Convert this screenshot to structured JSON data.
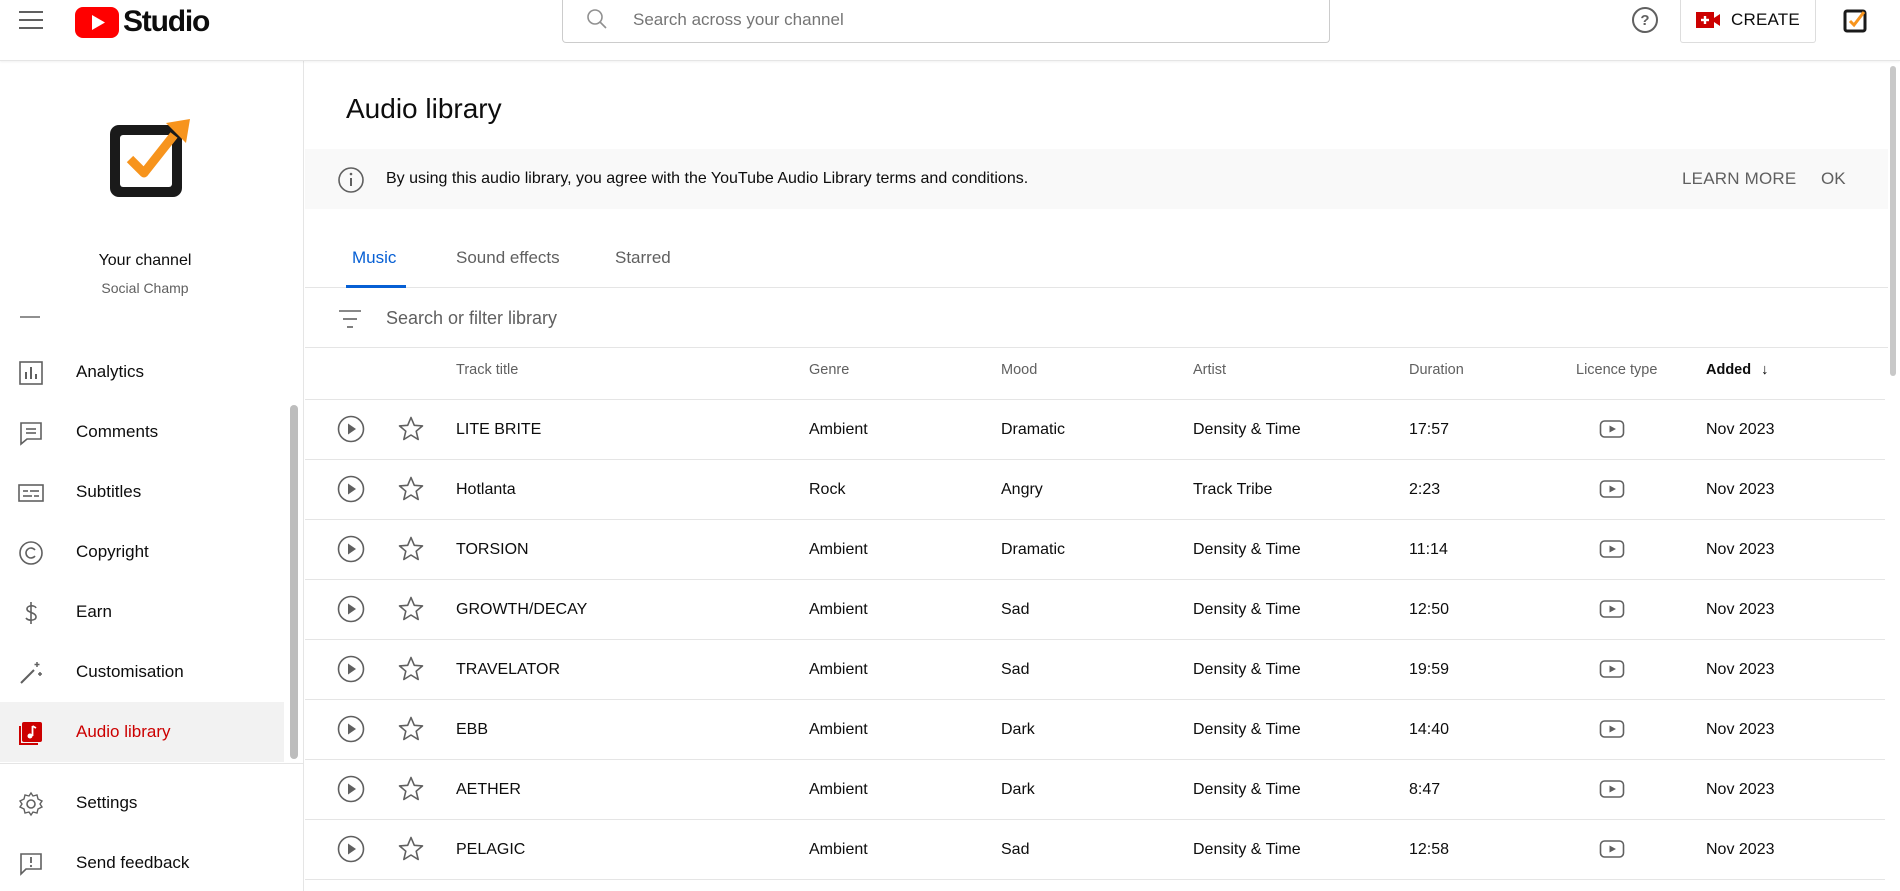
{
  "header": {
    "brand": "Studio",
    "search_placeholder": "Search across your channel",
    "create_label": "CREATE",
    "help_symbol": "?",
    "icons": {
      "menu": "hamburger-icon",
      "search": "search-icon",
      "help": "help-icon",
      "create": "video-plus-icon"
    },
    "brand_color": "#ff0000"
  },
  "channel": {
    "name": "Your channel",
    "subtitle": "Social Champ"
  },
  "nav": [
    {
      "label": "Analytics",
      "icon": "analytics-icon"
    },
    {
      "label": "Comments",
      "icon": "comments-icon"
    },
    {
      "label": "Subtitles",
      "icon": "subtitles-icon"
    },
    {
      "label": "Copyright",
      "icon": "copyright-icon"
    },
    {
      "label": "Earn",
      "icon": "dollar-icon"
    },
    {
      "label": "Customisation",
      "icon": "magic-wand-icon"
    },
    {
      "label": "Audio library",
      "icon": "audio-library-icon",
      "active": true
    },
    {
      "label": "Settings",
      "icon": "gear-icon"
    },
    {
      "label": "Send feedback",
      "icon": "feedback-icon"
    }
  ],
  "page": {
    "title": "Audio library",
    "notice": "By using this audio library, you agree with the YouTube Audio Library terms and conditions.",
    "learn_more": "LEARN MORE",
    "ok": "OK",
    "tabs": [
      {
        "label": "Music",
        "active": true
      },
      {
        "label": "Sound effects"
      },
      {
        "label": "Starred"
      }
    ],
    "filter_placeholder": "Search or filter library",
    "accent_color": "#065fd4",
    "active_nav_color": "#cc0000"
  },
  "table": {
    "columns": {
      "track_title": "Track title",
      "genre": "Genre",
      "mood": "Mood",
      "artist": "Artist",
      "duration": "Duration",
      "licence_type": "Licence type",
      "added": "Added",
      "sort_indicator": "↓"
    },
    "rows": [
      {
        "title": "LITE BRITE",
        "genre": "Ambient",
        "mood": "Dramatic",
        "artist": "Density & Time",
        "duration": "17:57",
        "added": "Nov 2023"
      },
      {
        "title": "Hotlanta",
        "genre": "Rock",
        "mood": "Angry",
        "artist": "Track Tribe",
        "duration": "2:23",
        "added": "Nov 2023"
      },
      {
        "title": "TORSION",
        "genre": "Ambient",
        "mood": "Dramatic",
        "artist": "Density & Time",
        "duration": "11:14",
        "added": "Nov 2023"
      },
      {
        "title": "GROWTH/DECAY",
        "genre": "Ambient",
        "mood": "Sad",
        "artist": "Density & Time",
        "duration": "12:50",
        "added": "Nov 2023"
      },
      {
        "title": "TRAVELATOR",
        "genre": "Ambient",
        "mood": "Sad",
        "artist": "Density & Time",
        "duration": "19:59",
        "added": "Nov 2023"
      },
      {
        "title": "EBB",
        "genre": "Ambient",
        "mood": "Dark",
        "artist": "Density & Time",
        "duration": "14:40",
        "added": "Nov 2023"
      },
      {
        "title": "AETHER",
        "genre": "Ambient",
        "mood": "Dark",
        "artist": "Density & Time",
        "duration": "8:47",
        "added": "Nov 2023"
      },
      {
        "title": "PELAGIC",
        "genre": "Ambient",
        "mood": "Sad",
        "artist": "Density & Time",
        "duration": "12:58",
        "added": "Nov 2023"
      }
    ]
  }
}
